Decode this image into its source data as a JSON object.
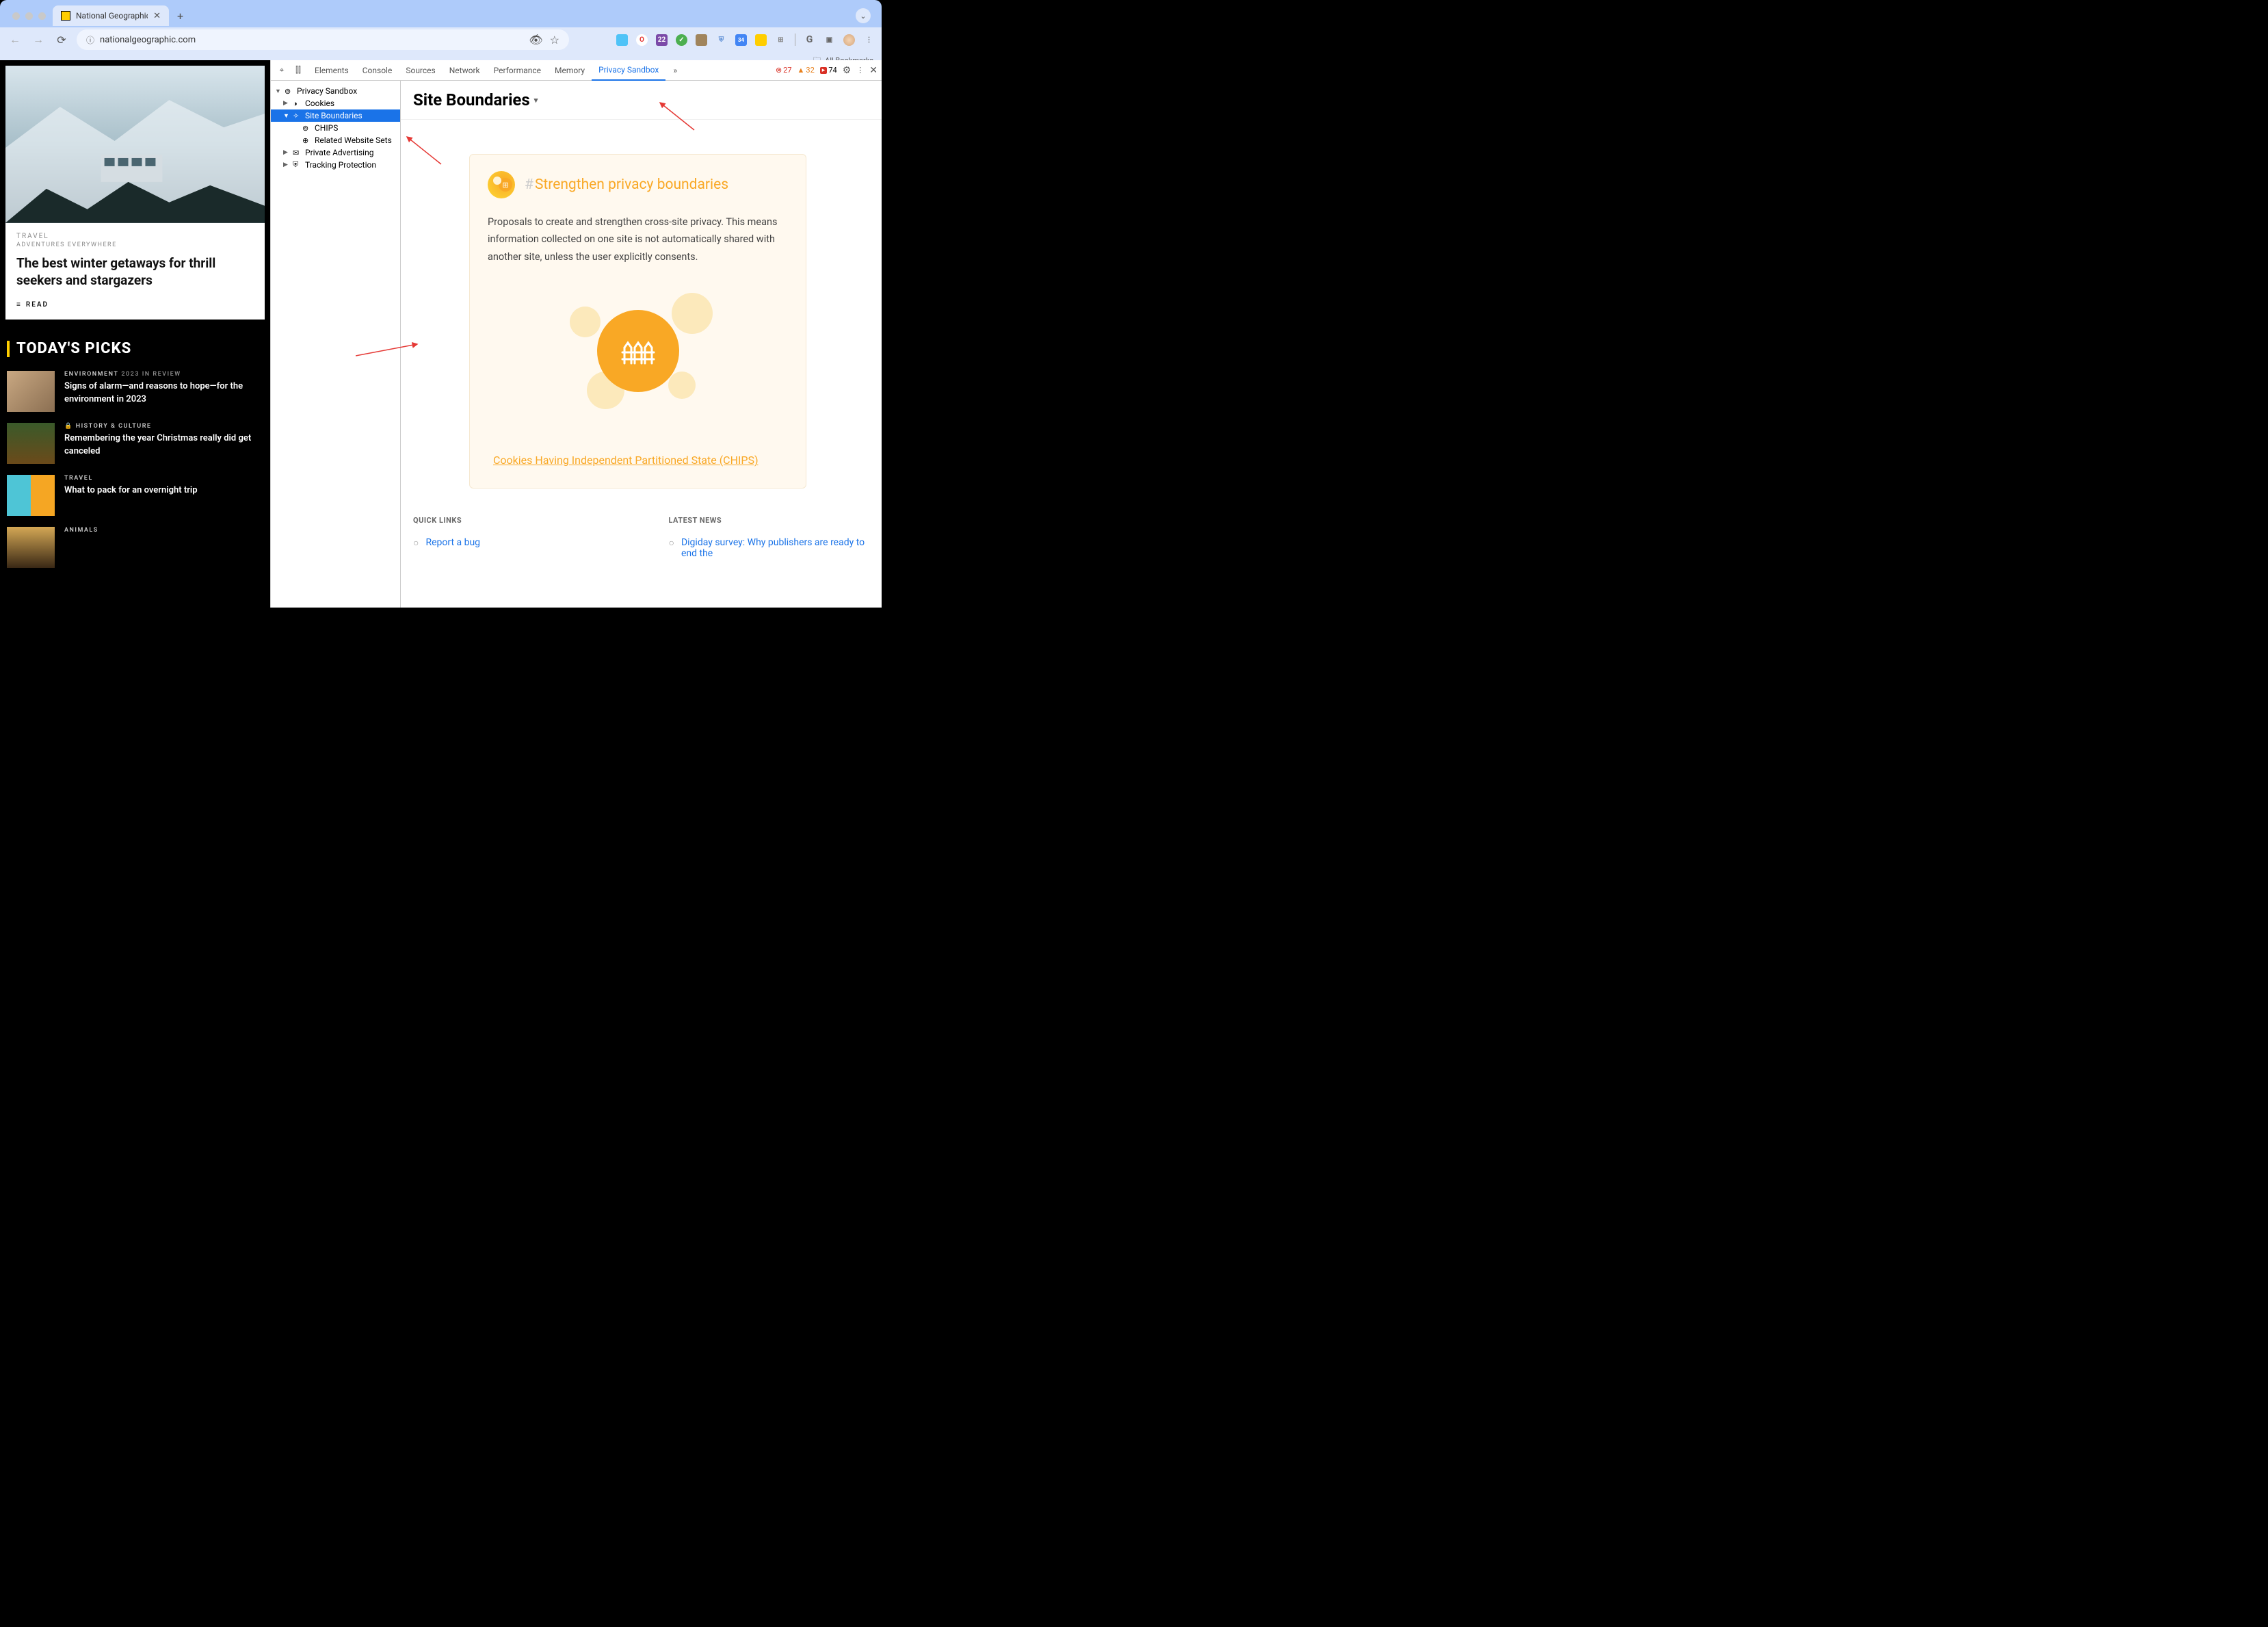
{
  "browser": {
    "tab_title": "National Geographic",
    "url": "nationalgeographic.com",
    "bookmarks_label": "All Bookmarks"
  },
  "hero": {
    "kicker": "TRAVEL",
    "sub": "ADVENTURES EVERYWHERE",
    "title": "The best winter getaways for thrill seekers and stargazers",
    "read": "READ"
  },
  "picks": {
    "heading": "TODAY'S PICKS",
    "items": [
      {
        "cat": "ENVIRONMENT",
        "yr": "2023 IN REVIEW",
        "headline": "Signs of alarm—and reasons to hope—for the environment in 2023",
        "thumb": "linear-gradient(135deg,#c9a882,#8b6f52)"
      },
      {
        "cat": "HISTORY & CULTURE",
        "yr": "",
        "headline": "Remembering the year Christmas really did get canceled",
        "lock": true,
        "thumb": "linear-gradient(180deg,#3a5a2a,#6b4a1a)"
      },
      {
        "cat": "TRAVEL",
        "yr": "",
        "headline": "What to pack for an overnight trip",
        "thumb": "linear-gradient(90deg,#4ec5d6 50%,#f5a623 50%)"
      },
      {
        "cat": "ANIMALS",
        "yr": "",
        "headline": "",
        "thumb": "linear-gradient(180deg,#d4a855,#3a2815)"
      }
    ]
  },
  "devtools": {
    "tabs": [
      "Elements",
      "Console",
      "Sources",
      "Network",
      "Performance",
      "Memory",
      "Privacy Sandbox"
    ],
    "active_tab": "Privacy Sandbox",
    "errors": "27",
    "warnings": "32",
    "info": "74",
    "tree": {
      "root": "Privacy Sandbox",
      "cookies": "Cookies",
      "site_boundaries": "Site Boundaries",
      "chips": "CHIPS",
      "rws": "Related Website Sets",
      "private_ad": "Private Advertising",
      "tracking": "Tracking Protection"
    },
    "panel_title": "Site Boundaries",
    "card": {
      "title": "Strengthen privacy boundaries",
      "desc": "Proposals to create and strengthen cross-site privacy. This means information collected on one site is not automatically shared with another site, unless the user explicitly consents.",
      "link": "Cookies Having Independent Partitioned State (CHIPS)"
    },
    "quick_links": {
      "heading": "QUICK LINKS",
      "item": "Report a bug"
    },
    "latest_news": {
      "heading": "LATEST NEWS",
      "item": "Digiday survey: Why publishers are ready to end the"
    }
  },
  "ext_badge": "22",
  "cal_badge": "34"
}
